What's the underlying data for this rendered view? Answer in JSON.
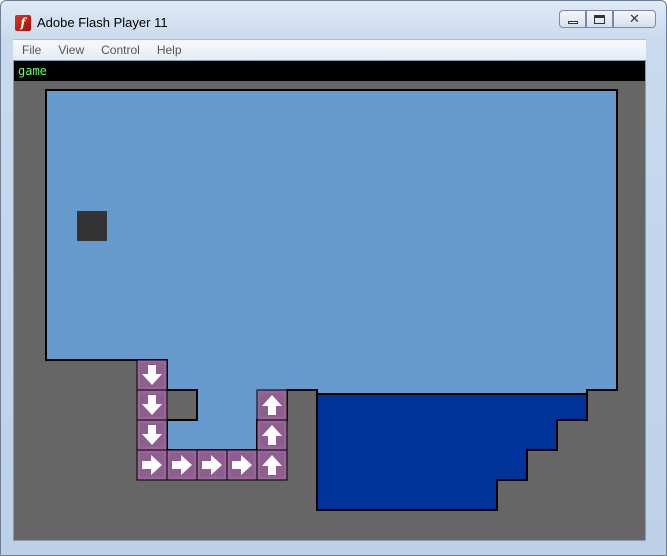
{
  "window": {
    "title": "Adobe Flash Player 11",
    "app_icon_glyph": "f",
    "minimize_glyph": "",
    "maximize_glyph": "",
    "close_glyph": "✕"
  },
  "menu": {
    "items": [
      "File",
      "View",
      "Control",
      "Help"
    ]
  },
  "game": {
    "title": "game"
  },
  "colors": {
    "background": "#666666",
    "water_light": "#6699cc",
    "water_dark": "#003399",
    "player": "#333333",
    "arrow_tile": "#996699",
    "header_text": "#66ff66"
  },
  "arrow_tiles": [
    {
      "direction": "down"
    },
    {
      "direction": "down"
    },
    {
      "direction": "down"
    },
    {
      "direction": "right"
    },
    {
      "direction": "right"
    },
    {
      "direction": "right"
    },
    {
      "direction": "right"
    },
    {
      "direction": "up"
    },
    {
      "direction": "up"
    },
    {
      "direction": "up"
    }
  ]
}
